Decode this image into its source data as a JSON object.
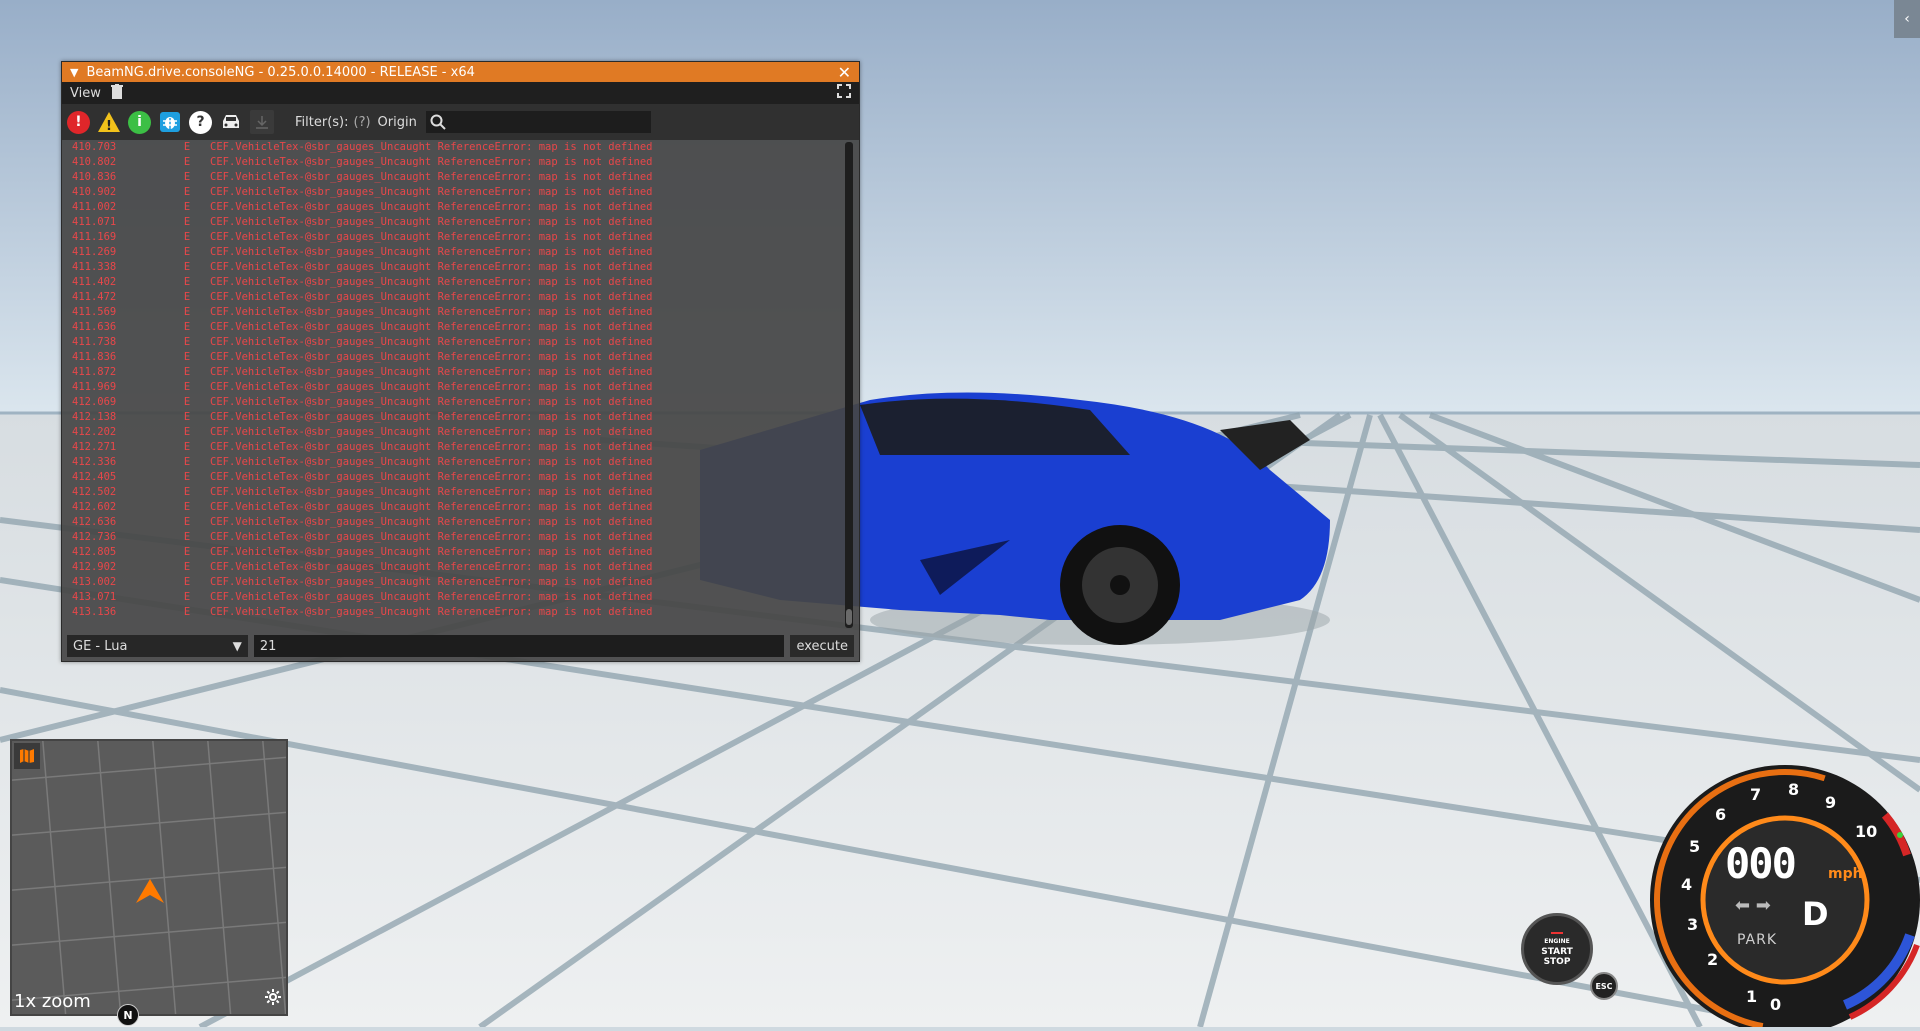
{
  "console": {
    "title": "BeamNG.drive.consoleNG - 0.25.0.0.14000 - RELEASE - x64",
    "menu_view": "View",
    "filter_label": "Filter(s):",
    "filter_help": "(?)",
    "filter_origin": "Origin",
    "filter_value": "",
    "language": "GE - Lua",
    "command_value": "21",
    "execute_label": "execute",
    "log_message": "CEF.VehicleTex-@sbr_gauges_Uncaught ReferenceError: map is not defined",
    "log_level": "E",
    "log_timestamps": [
      "410.703",
      "410.802",
      "410.836",
      "410.902",
      "411.002",
      "411.071",
      "411.169",
      "411.269",
      "411.338",
      "411.402",
      "411.472",
      "411.569",
      "411.636",
      "411.738",
      "411.836",
      "411.872",
      "411.969",
      "412.069",
      "412.138",
      "412.202",
      "412.271",
      "412.336",
      "412.405",
      "412.502",
      "412.602",
      "412.636",
      "412.736",
      "412.805",
      "412.902",
      "413.002",
      "413.071",
      "413.136"
    ]
  },
  "minimap": {
    "zoom_label": "1x zoom",
    "north_label": "N"
  },
  "engine_button": {
    "line1": "ENGINE",
    "line2": "START",
    "line3": "STOP"
  },
  "esc_label": "ESC",
  "gauge": {
    "speed": "000",
    "unit": "mph",
    "status": "PARK",
    "gear": "D",
    "rpm_labels": [
      "0",
      "1",
      "2",
      "3",
      "4",
      "5",
      "6",
      "7",
      "8",
      "9",
      "10"
    ]
  },
  "colors": {
    "title_bar": "#e07a24",
    "log_error": "#e8474a",
    "car_blue": "#1a3fd1",
    "gauge_accent": "#ff8a1a"
  }
}
